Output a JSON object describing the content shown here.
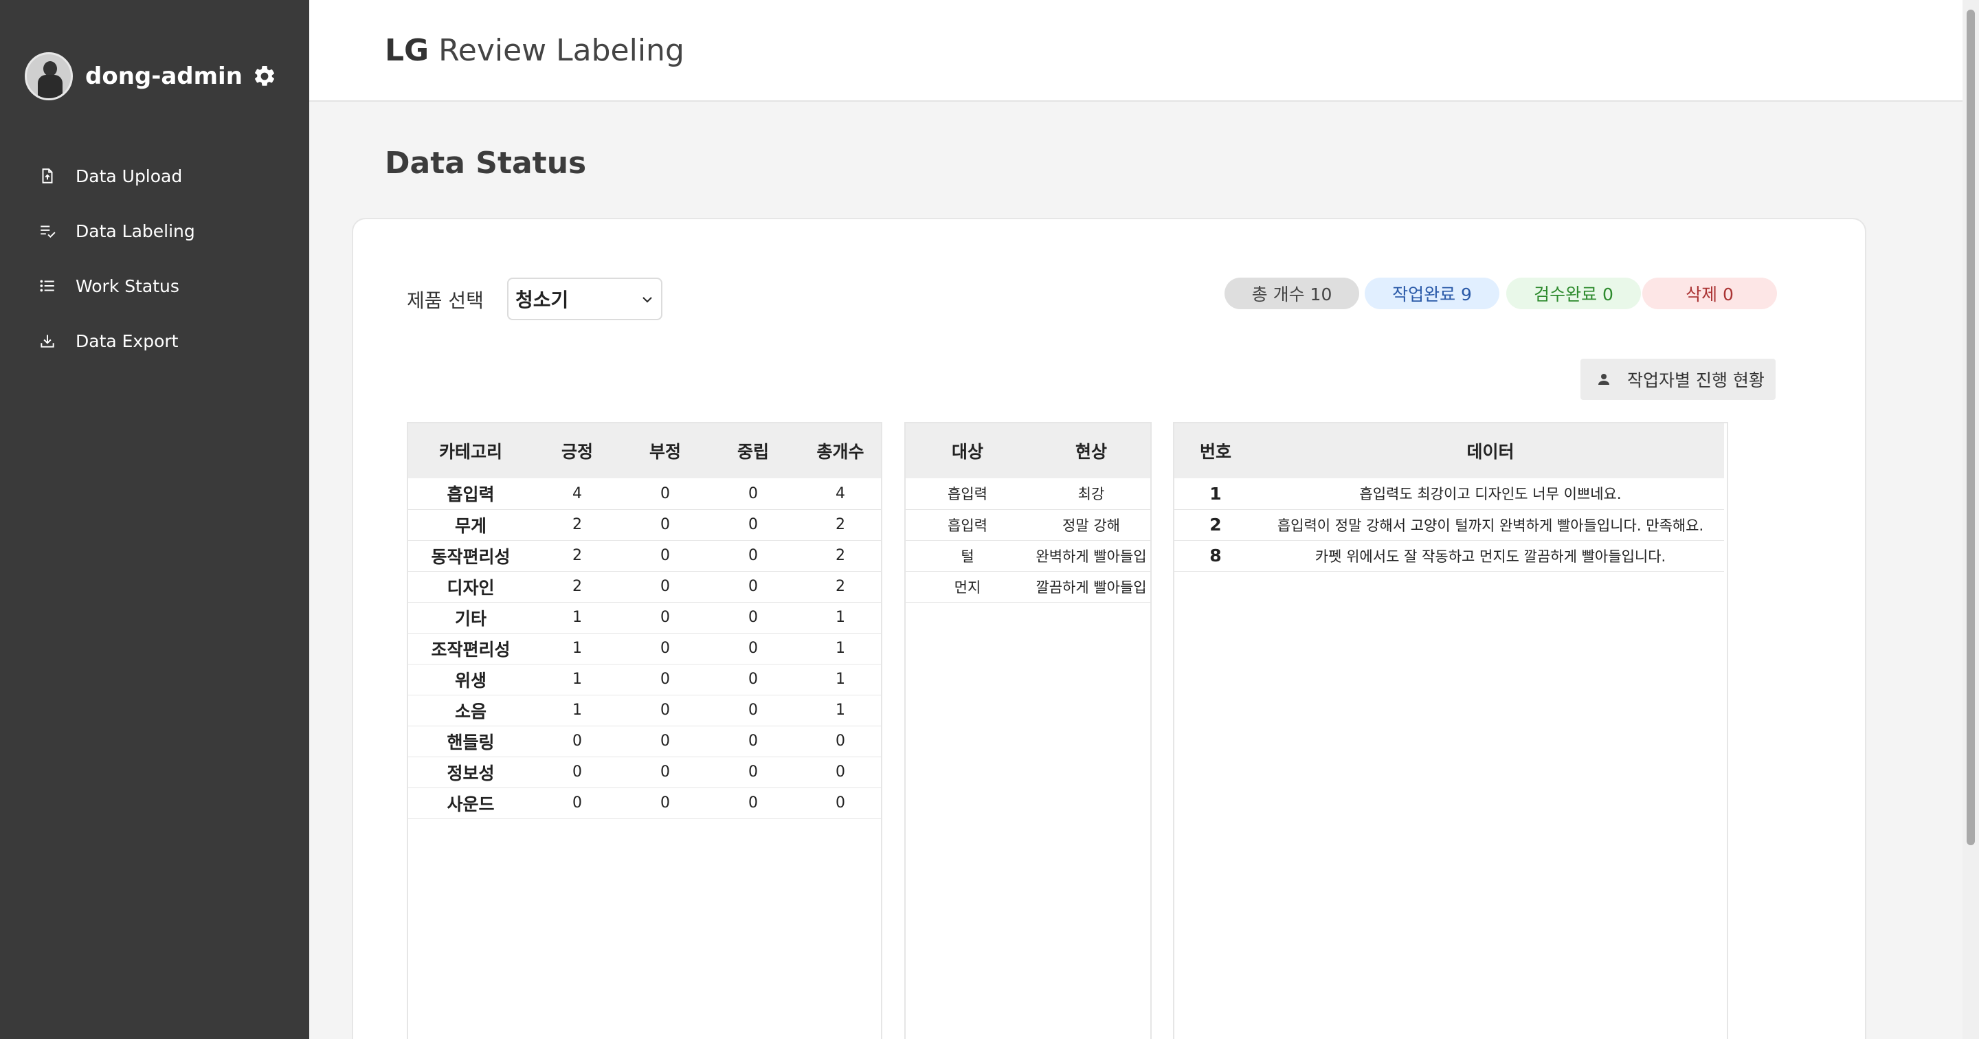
{
  "user": {
    "name": "dong-admin"
  },
  "sidebar": {
    "items": [
      {
        "label": "Data Upload",
        "icon": "file-upload-icon"
      },
      {
        "label": "Data Labeling",
        "icon": "list-check-icon"
      },
      {
        "label": "Work Status",
        "icon": "list-icon"
      },
      {
        "label": "Data Export",
        "icon": "download-icon"
      }
    ]
  },
  "header": {
    "brand": "LG",
    "title": "Review Labeling"
  },
  "page": {
    "title": "Data Status"
  },
  "product": {
    "label": "제품 선택",
    "selected": "청소기"
  },
  "badges": {
    "total": "총 개수 10",
    "done": "작업완료 9",
    "reviewed": "검수완료 0",
    "deleted": "삭제 0"
  },
  "worker_button": {
    "label": "작업자별 진행 현황"
  },
  "category_table": {
    "headers": [
      "카테고리",
      "긍정",
      "부정",
      "중립",
      "총개수"
    ],
    "rows": [
      [
        "흡입력",
        "4",
        "0",
        "0",
        "4"
      ],
      [
        "무게",
        "2",
        "0",
        "0",
        "2"
      ],
      [
        "동작편리성",
        "2",
        "0",
        "0",
        "2"
      ],
      [
        "디자인",
        "2",
        "0",
        "0",
        "2"
      ],
      [
        "기타",
        "1",
        "0",
        "0",
        "1"
      ],
      [
        "조작편리성",
        "1",
        "0",
        "0",
        "1"
      ],
      [
        "위생",
        "1",
        "0",
        "0",
        "1"
      ],
      [
        "소음",
        "1",
        "0",
        "0",
        "1"
      ],
      [
        "핸들링",
        "0",
        "0",
        "0",
        "0"
      ],
      [
        "정보성",
        "0",
        "0",
        "0",
        "0"
      ],
      [
        "사운드",
        "0",
        "0",
        "0",
        "0"
      ]
    ]
  },
  "target_table": {
    "headers": [
      "대상",
      "현상"
    ],
    "rows": [
      [
        "흡입력",
        "최강"
      ],
      [
        "흡입력",
        "정말 강해"
      ],
      [
        "털",
        "완벽하게 빨아들입"
      ],
      [
        "먼지",
        "깔끔하게 빨아들입"
      ]
    ]
  },
  "data_table": {
    "headers": [
      "번호",
      "데이터"
    ],
    "rows": [
      [
        "1",
        "흡입력도 최강이고 디자인도 너무 이쁘네요."
      ],
      [
        "2",
        "흡입력이 정말 강해서 고양이 털까지 완벽하게 빨아들입니다. 만족해요."
      ],
      [
        "8",
        "카펫 위에서도 잘 작동하고 먼지도 깔끔하게 빨아들입니다."
      ]
    ]
  }
}
